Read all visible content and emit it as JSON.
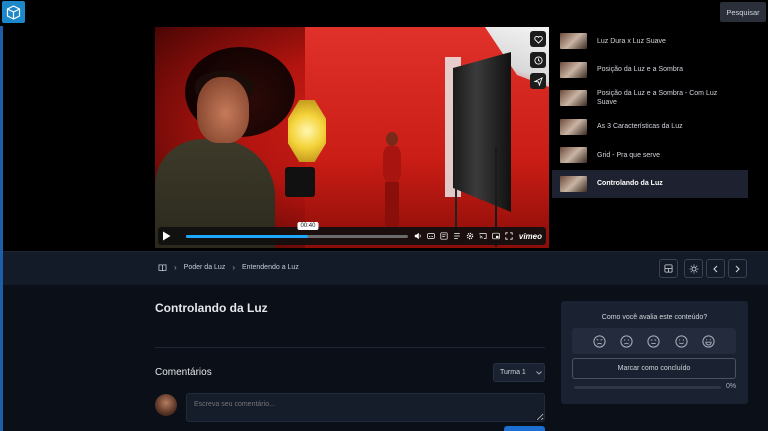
{
  "header": {
    "search_label": "Pesquisar"
  },
  "player": {
    "current_time": "00:40",
    "progress": 0.55,
    "brand": "vimeo"
  },
  "playlist": {
    "items": [
      {
        "title": "Luz Dura x Luz Suave",
        "active": false
      },
      {
        "title": "Posição da Luz e a Sombra",
        "active": false
      },
      {
        "title": "Posição da Luz e a Sombra - Com Luz Suave",
        "active": false
      },
      {
        "title": "As 3 Características da Luz",
        "active": false
      },
      {
        "title": "Grid - Pra que serve",
        "active": false
      },
      {
        "title": "Controlando da Luz",
        "active": true
      }
    ]
  },
  "breadcrumb": {
    "items": [
      "Poder da Luz",
      "Entendendo a Luz"
    ]
  },
  "lesson": {
    "title": "Controlando da Luz"
  },
  "comments": {
    "heading": "Comentários",
    "class_select": "Turma 1",
    "placeholder": "Escreva seu comentário..."
  },
  "rating": {
    "question": "Como você avalia este conteúdo?",
    "mark_complete_label": "Marcar como concluído",
    "progress_percent": "0%"
  },
  "colors": {
    "accent": "#1ea7fd",
    "background": "#0b0f18",
    "panel": "#1a2130"
  }
}
